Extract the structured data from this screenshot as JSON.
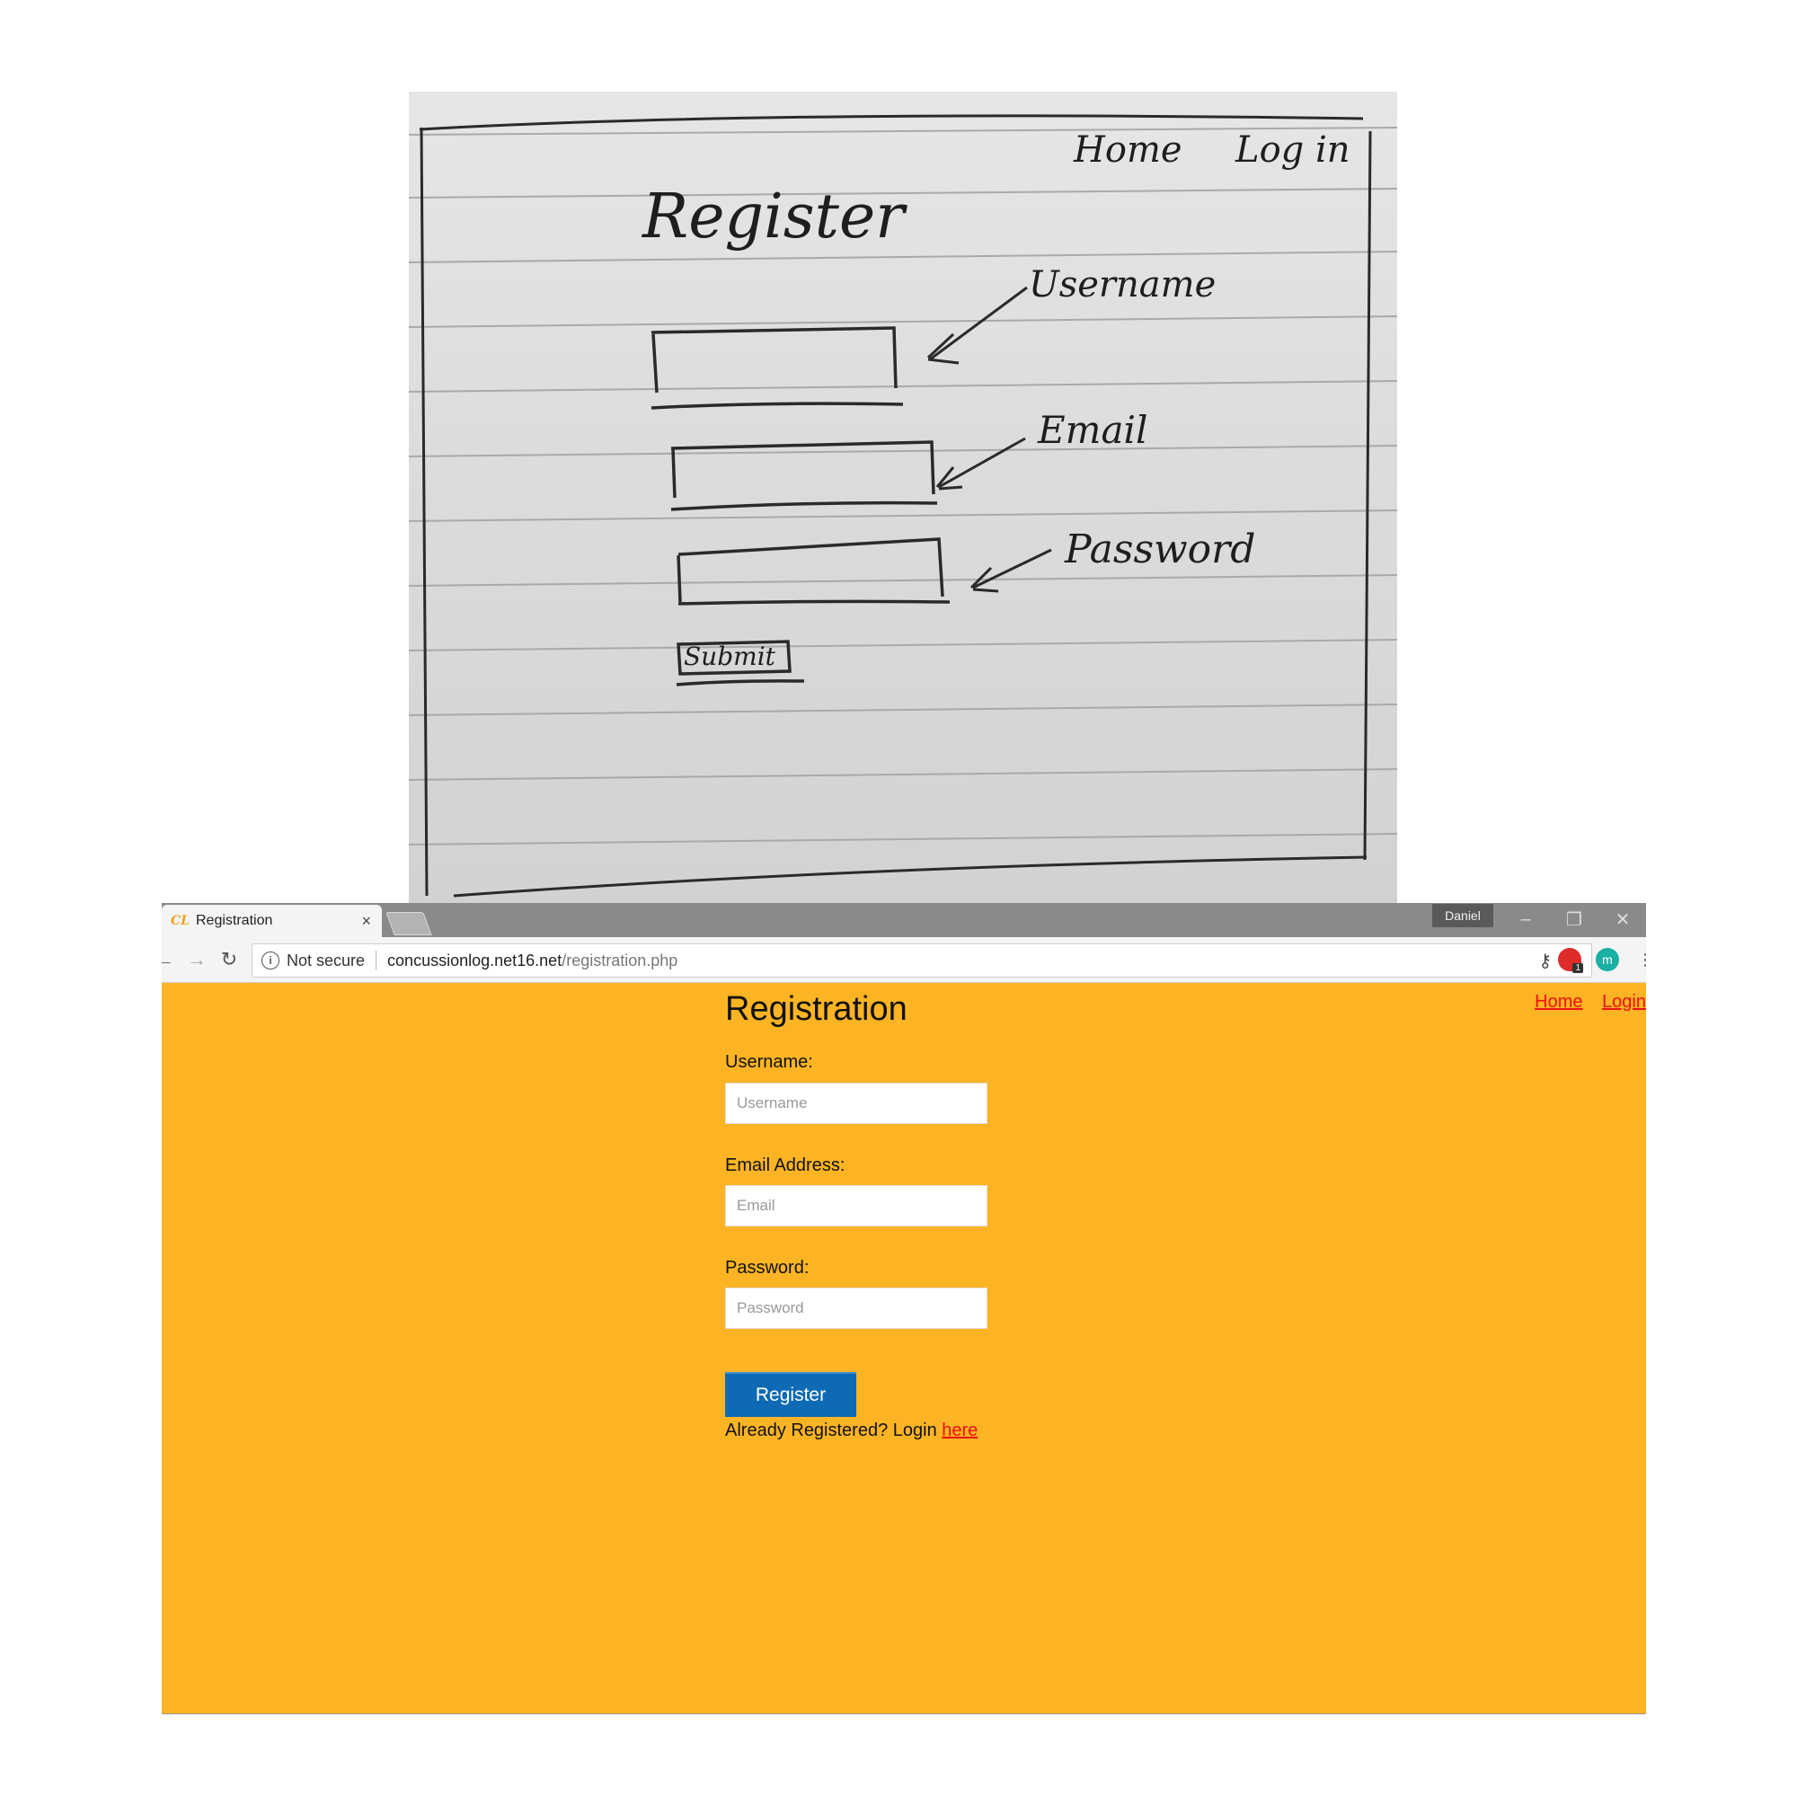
{
  "sketch": {
    "nav_home": "Home",
    "nav_login": "Log in",
    "title": "Register",
    "annotation_username": "Username",
    "annotation_email": "Email",
    "annotation_password": "Password",
    "submit_label": "Submit"
  },
  "browser": {
    "tab_title": "Registration",
    "tab_close": "×",
    "favicon": "CL",
    "profile_name": "Daniel",
    "security_label": "Not secure",
    "url_host": "concussionlog.net16.net",
    "url_path": "/registration.php",
    "icons": [
      "back-arrow-icon",
      "forward-arrow-icon",
      "reload-icon",
      "info-icon",
      "key-icon",
      "star-icon",
      "extension-icon",
      "menu-dots-icon"
    ],
    "extension_badge": "1",
    "extension_letter": "m"
  },
  "page": {
    "title": "Registration",
    "nav": {
      "home": "Home",
      "login": "Login"
    },
    "form": {
      "username_label": "Username:",
      "username_placeholder": "Username",
      "email_label": "Email Address:",
      "email_placeholder": "Email",
      "password_label": "Password:",
      "password_placeholder": "Password",
      "submit_label": "Register"
    },
    "footer_text": "Already Registered? Login ",
    "footer_link": "here"
  },
  "colors": {
    "page_background": "#fcb424",
    "link": "#ee1111",
    "button": "#0e6ab4"
  }
}
